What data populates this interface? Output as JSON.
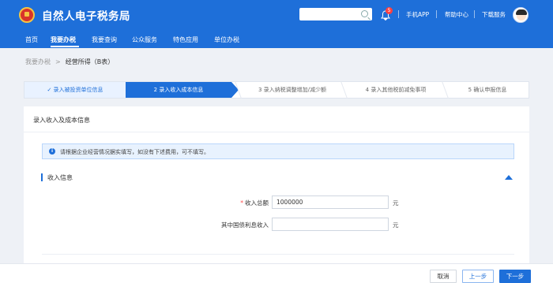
{
  "header": {
    "title": "自然人电子税务局",
    "links": [
      "手机APP",
      "帮助中心",
      "下载服务"
    ],
    "notification_count": "5",
    "icons": [
      "emblem-icon",
      "search-icon",
      "bell-icon",
      "avatar-icon"
    ]
  },
  "search": {
    "placeholder": ""
  },
  "nav": {
    "items": [
      "首页",
      "我要办税",
      "我要查询",
      "公众服务",
      "特色应用",
      "单位办税"
    ],
    "active": "我要办税"
  },
  "breadcrumb": {
    "parent": "我要办税",
    "separator": ">",
    "current": "经营所得（B表）"
  },
  "steps": [
    "✓ 录入被投资单位信息",
    "2 录入收入成本信息",
    "3 录入纳税调整增加/减少额",
    "4 录入其他税前减免事项",
    "5 确认申报信息"
  ],
  "card": {
    "title": "录入收入及成本信息",
    "notice": "请根据企业经营情况据实填写，如没有下述费用，可不填写。",
    "section_title": "收入信息",
    "fields": [
      {
        "label": "收入总额",
        "required": "*",
        "value": "1000000",
        "unit": "元"
      },
      {
        "label": "其中国债利息收入",
        "required": "",
        "value": "",
        "unit": "元"
      }
    ]
  },
  "footer": {
    "cancel": "取消",
    "prev": "上一步",
    "next": "下一步"
  },
  "colors": {
    "primary": "#1e6fd9",
    "required": "#ff4d4f",
    "page_bg": "#eef1f6"
  }
}
